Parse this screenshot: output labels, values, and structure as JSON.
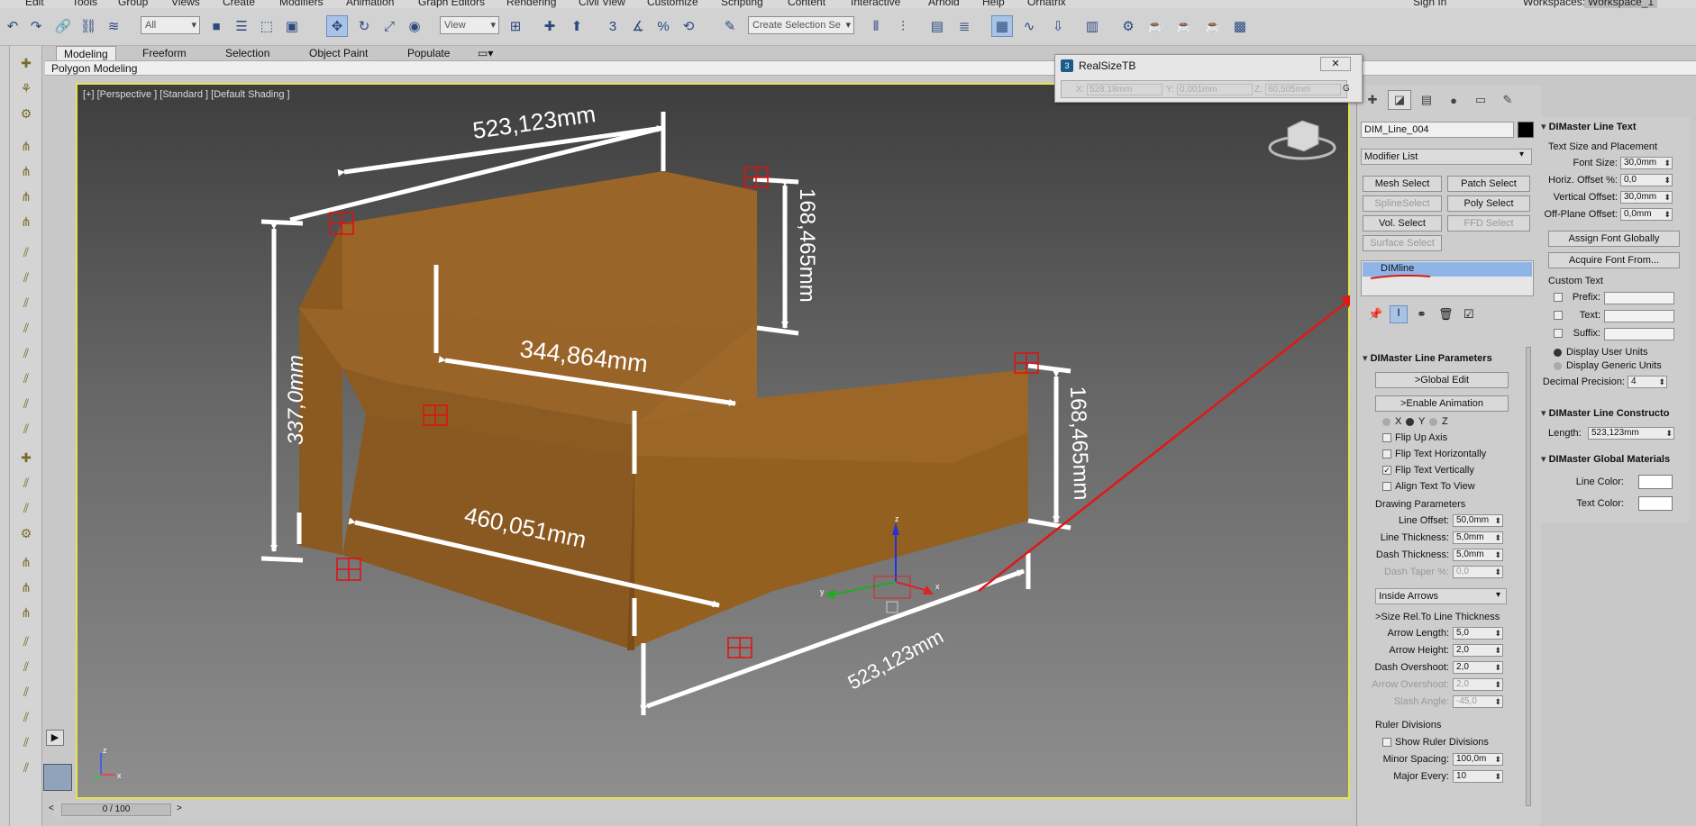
{
  "menu": [
    "Edit",
    "Tools",
    "Group",
    "Views",
    "Create",
    "Modifiers",
    "Animation",
    "Graph Editors",
    "Rendering",
    "Civil View",
    "Customize",
    "Scripting",
    "Content",
    "Interactive",
    "Arnold",
    "Help",
    "Ornatrix"
  ],
  "signin": "Sign In",
  "workspaces_label": "Workspaces:",
  "workspace_value": "Workspace_1",
  "toolbar": {
    "filter": "All",
    "view": "View",
    "selection_set": "Create Selection Se"
  },
  "ribbon_tabs": [
    "Modeling",
    "Freeform",
    "Selection",
    "Object Paint",
    "Populate"
  ],
  "subribbon": "Polygon Modeling",
  "viewport_label": "[+] [Perspective ] [Standard ] [Default Shading ]",
  "dims": {
    "top": "523,123mm",
    "top_right": "168,465mm",
    "left": "337,0mm",
    "middle": "344,864mm",
    "right": "168,465mm",
    "bottom": "460,051mm",
    "bottom_right": "523,123mm"
  },
  "axis": {
    "x": "x",
    "y": "y",
    "z": "z"
  },
  "timeline": "0 / 100",
  "realsize": {
    "title": "RealSizeTB",
    "close": "✕",
    "x_label": "X:",
    "x": "528,18mm",
    "y_label": "Y:",
    "y": "0,001mm",
    "z_label": "Z:",
    "z": "60,505mm",
    "g": "G"
  },
  "modifier": {
    "object_name": "DIM_Line_004",
    "list": "Modifier List",
    "buttons": [
      "Mesh Select",
      "Patch Select",
      "SplineSelect",
      "Poly Select",
      "Vol. Select",
      "FFD Select",
      "Surface Select"
    ],
    "stack_item": "DIMline"
  },
  "params": {
    "header": "DIMaster Line Parameters",
    "global_edit": ">Global Edit",
    "enable_animation": ">Enable Animation",
    "axes": [
      "X",
      "Y",
      "Z"
    ],
    "flip_up": "Flip Up Axis",
    "flip_h": "Flip Text Horizontally",
    "flip_v": "Flip Text Vertically",
    "align_view": "Align Text To View",
    "drawing": "Drawing Parameters",
    "line_offset_l": "Line Offset:",
    "line_offset": "50,0mm",
    "line_thick_l": "Line Thickness:",
    "line_thick": "5,0mm",
    "dash_thick_l": "Dash Thickness:",
    "dash_thick": "5,0mm",
    "dash_taper_l": "Dash Taper %:",
    "dash_taper": "0,0",
    "arrows": "Inside Arrows",
    "size_rel": ">Size Rel.To Line Thickness",
    "arrow_len_l": "Arrow Length:",
    "arrow_len": "5,0",
    "arrow_h_l": "Arrow Height:",
    "arrow_h": "2,0",
    "dash_over_l": "Dash Overshoot:",
    "dash_over": "2,0",
    "arrow_over_l": "Arrow Overshoot:",
    "arrow_over": "2,0",
    "slash_l": "Slash Angle:",
    "slash": "-45,0",
    "ruler": "Ruler Divisions",
    "show_ruler": "Show Ruler Divisions",
    "minor_l": "Minor Spacing:",
    "minor": "100,0m",
    "major_l": "Major Every:",
    "major": "10"
  },
  "text": {
    "header": "DIMaster Line Text",
    "size_place": "Text Size and Placement",
    "font_size_l": "Font Size:",
    "font_size": "30,0mm",
    "hoff_l": "Horiz. Offset %:",
    "hoff": "0,0",
    "voff_l": "Vertical Offset:",
    "voff": "30,0mm",
    "poff_l": "Off-Plane Offset:",
    "poff": "0,0mm",
    "assign_font": "Assign Font Globally",
    "acquire_font": "Acquire Font From...",
    "custom": "Custom Text",
    "prefix": "Prefix:",
    "text": "Text:",
    "suffix": "Suffix:",
    "user_units": "Display User Units",
    "generic_units": "Display Generic Units",
    "decimal_l": "Decimal Precision:",
    "decimal": "4"
  },
  "constructor": {
    "header": "DIMaster Line Constructo",
    "length_l": "Length:",
    "length": "523,123mm"
  },
  "materials": {
    "header": "DIMaster Global Materials",
    "line_color": "Line Color:",
    "text_color": "Text Color:"
  }
}
